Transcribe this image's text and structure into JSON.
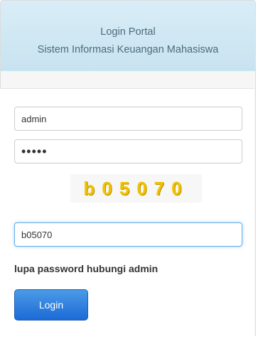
{
  "header": {
    "title": "Login Portal",
    "subtitle": "Sistem Informasi Keuangan Mahasiswa"
  },
  "form": {
    "username_value": "admin",
    "password_mask": "•••••",
    "captcha_text": "b05070",
    "captcha_input_value": "b05070",
    "forgot_hint": "lupa password hubungi admin",
    "login_label": "Login"
  },
  "colors": {
    "header_bg": "#d9edf7",
    "captcha_text": "#f2c200",
    "button": "#1c6ad6"
  }
}
